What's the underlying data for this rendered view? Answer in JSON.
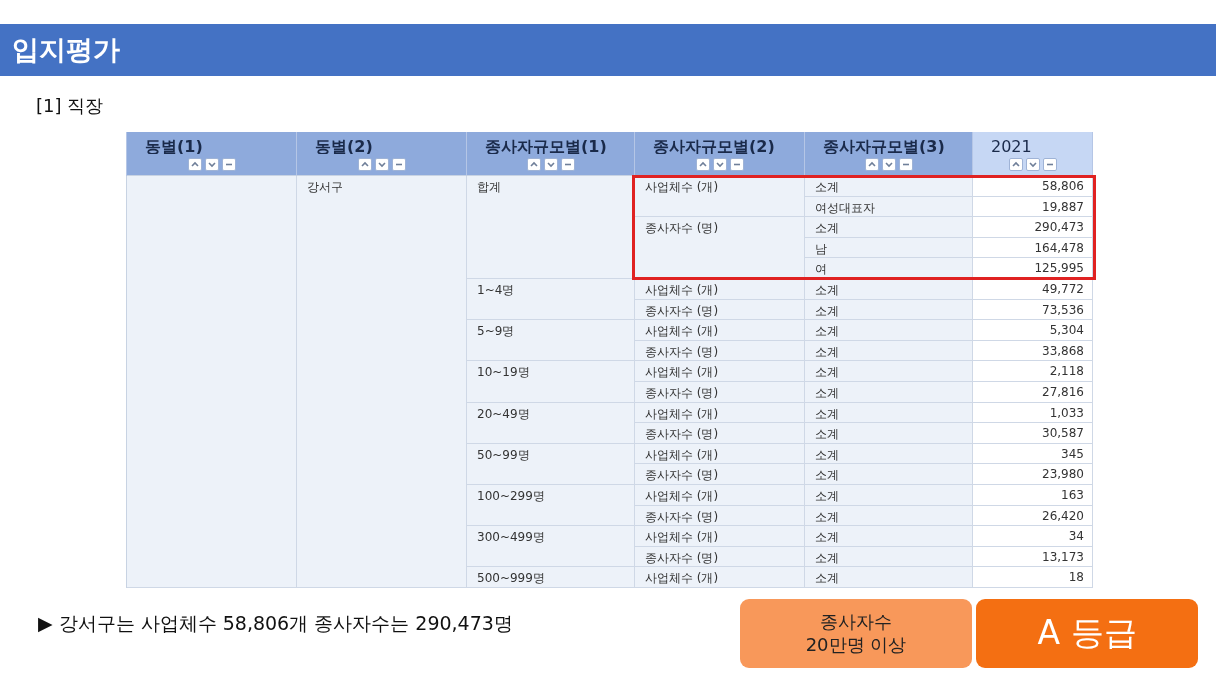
{
  "slide": {
    "title": "입지평가",
    "section": "[1] 직장"
  },
  "table": {
    "columns": [
      {
        "label": "동별(1)",
        "kind": "dimension"
      },
      {
        "label": "동별(2)",
        "kind": "dimension"
      },
      {
        "label": "종사자규모별(1)",
        "kind": "dimension"
      },
      {
        "label": "종사자규모별(2)",
        "kind": "dimension"
      },
      {
        "label": "종사자규모별(3)",
        "kind": "dimension"
      },
      {
        "label": "2021",
        "kind": "period"
      }
    ],
    "district": "강서구",
    "groups": [
      {
        "label": "합계",
        "highlighted": true,
        "measures": [
          {
            "label": "사업체수 (개)",
            "rows": [
              {
                "label": "소계",
                "value": "58,806"
              },
              {
                "label": "여성대표자",
                "value": "19,887"
              }
            ]
          },
          {
            "label": "종사자수 (명)",
            "rows": [
              {
                "label": "소계",
                "value": "290,473"
              },
              {
                "label": "남",
                "value": "164,478"
              },
              {
                "label": "여",
                "value": "125,995"
              }
            ]
          }
        ]
      },
      {
        "label": "1~4명",
        "highlighted": false,
        "measures": [
          {
            "label": "사업체수 (개)",
            "rows": [
              {
                "label": "소계",
                "value": "49,772"
              }
            ]
          },
          {
            "label": "종사자수 (명)",
            "rows": [
              {
                "label": "소계",
                "value": "73,536"
              }
            ]
          }
        ]
      },
      {
        "label": "5~9명",
        "highlighted": false,
        "measures": [
          {
            "label": "사업체수 (개)",
            "rows": [
              {
                "label": "소계",
                "value": "5,304"
              }
            ]
          },
          {
            "label": "종사자수 (명)",
            "rows": [
              {
                "label": "소계",
                "value": "33,868"
              }
            ]
          }
        ]
      },
      {
        "label": "10~19명",
        "highlighted": false,
        "measures": [
          {
            "label": "사업체수 (개)",
            "rows": [
              {
                "label": "소계",
                "value": "2,118"
              }
            ]
          },
          {
            "label": "종사자수 (명)",
            "rows": [
              {
                "label": "소계",
                "value": "27,816"
              }
            ]
          }
        ]
      },
      {
        "label": "20~49명",
        "highlighted": false,
        "measures": [
          {
            "label": "사업체수 (개)",
            "rows": [
              {
                "label": "소계",
                "value": "1,033"
              }
            ]
          },
          {
            "label": "종사자수 (명)",
            "rows": [
              {
                "label": "소계",
                "value": "30,587"
              }
            ]
          }
        ]
      },
      {
        "label": "50~99명",
        "highlighted": false,
        "measures": [
          {
            "label": "사업체수 (개)",
            "rows": [
              {
                "label": "소계",
                "value": "345"
              }
            ]
          },
          {
            "label": "종사자수 (명)",
            "rows": [
              {
                "label": "소계",
                "value": "23,980"
              }
            ]
          }
        ]
      },
      {
        "label": "100~299명",
        "highlighted": false,
        "measures": [
          {
            "label": "사업체수 (개)",
            "rows": [
              {
                "label": "소계",
                "value": "163"
              }
            ]
          },
          {
            "label": "종사자수 (명)",
            "rows": [
              {
                "label": "소계",
                "value": "26,420"
              }
            ]
          }
        ]
      },
      {
        "label": "300~499명",
        "highlighted": false,
        "measures": [
          {
            "label": "사업체수 (개)",
            "rows": [
              {
                "label": "소계",
                "value": "34"
              }
            ]
          },
          {
            "label": "종사자수 (명)",
            "rows": [
              {
                "label": "소계",
                "value": "13,173"
              }
            ]
          }
        ]
      },
      {
        "label": "500~999명",
        "highlighted": false,
        "measures": [
          {
            "label": "사업체수 (개)",
            "rows": [
              {
                "label": "소계",
                "value": "18"
              }
            ]
          }
        ]
      }
    ]
  },
  "summary": {
    "text": "▶ 강서구는 사업체수 58,806개 종사자수는 290,473명",
    "criterion": "종사자수\n20만명 이상",
    "grade": "A 등급"
  }
}
